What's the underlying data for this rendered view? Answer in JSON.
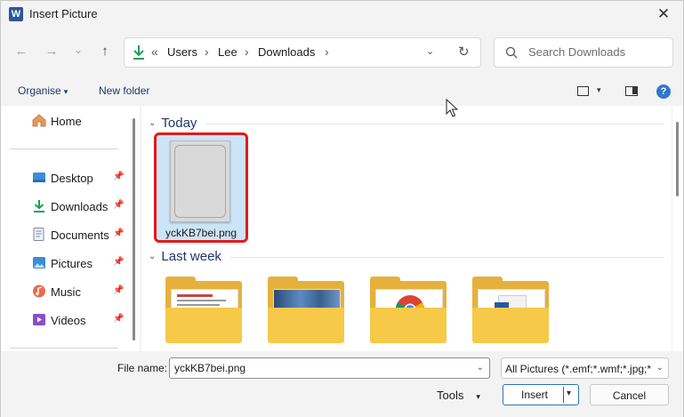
{
  "window": {
    "app_icon_letter": "W",
    "title": "Insert Picture",
    "close_glyph": "✕"
  },
  "nav": {
    "back_glyph": "←",
    "forward_glyph": "→",
    "recent_glyph": "⌄",
    "up_glyph": "↑",
    "address": {
      "overflow_glyph": "«",
      "crumbs": [
        "Users",
        "Lee",
        "Downloads"
      ],
      "sep_glyph": "›",
      "dropdown_glyph": "⌄",
      "refresh_glyph": "↻"
    },
    "search": {
      "placeholder": "Search Downloads"
    }
  },
  "commandbar": {
    "organise_label": "Organise",
    "organise_caret": "▾",
    "new_folder_label": "New folder",
    "view_caret": "▾",
    "help_glyph": "?"
  },
  "sidebar": {
    "items": [
      {
        "label": "Home",
        "icon": "home-icon"
      },
      {
        "label": "Desktop",
        "icon": "desktop-icon",
        "pinned": true
      },
      {
        "label": "Downloads",
        "icon": "downloads-icon",
        "pinned": true
      },
      {
        "label": "Documents",
        "icon": "documents-icon",
        "pinned": true
      },
      {
        "label": "Pictures",
        "icon": "pictures-icon",
        "pinned": true
      },
      {
        "label": "Music",
        "icon": "music-icon",
        "pinned": true
      },
      {
        "label": "Videos",
        "icon": "videos-icon",
        "pinned": true
      }
    ],
    "pin_glyph": "📌"
  },
  "files": {
    "groups": [
      {
        "label": "Today",
        "chev": "⌄"
      },
      {
        "label": "Last week",
        "chev": "⌄"
      }
    ],
    "selected_file": {
      "name": "yckKB7bei.png"
    },
    "highlight_color": "#e01b1b",
    "folder_color": "#f7c948"
  },
  "footer": {
    "file_name_label": "File name:",
    "file_name_value": "yckKB7bei.png",
    "filter_value": "All Pictures (*.emf;*.wmf;*.jpg;*",
    "dropdown_glyph": "⌄",
    "tools_label": "Tools",
    "tools_caret": "▾",
    "insert_label": "Insert",
    "insert_caret": "▾",
    "cancel_label": "Cancel"
  }
}
